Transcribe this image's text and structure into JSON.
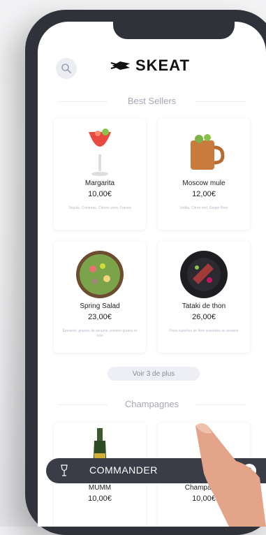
{
  "header": {
    "logo_text": "SKEAT"
  },
  "sections": {
    "best_sellers": "Best Sellers",
    "champagnes": "Champagnes"
  },
  "products": [
    {
      "name": "Margarita",
      "price": "10,00€",
      "desc": "Tequila, Cointreau, Citrons verts, Fraises"
    },
    {
      "name": "Moscow mule",
      "price": "12,00€",
      "desc": "Vodka, Citron vert, Ginger Beer"
    },
    {
      "name": "Spring Salad",
      "price": "23,00€",
      "desc": "Épinards, graines de sésame, pomme granny et noix"
    },
    {
      "name": "Tataki de thon",
      "price": "26,00€",
      "desc": "Fines tranches de thon snackées au sésame"
    }
  ],
  "see_more": "Voir 3 de plus",
  "champagne_cards": [
    {
      "name": "MUMM",
      "price": "10,00€"
    },
    {
      "name": "Champagne",
      "price": "10,00€"
    }
  ],
  "cart": {
    "label": "COMMANDER",
    "count": "2"
  }
}
